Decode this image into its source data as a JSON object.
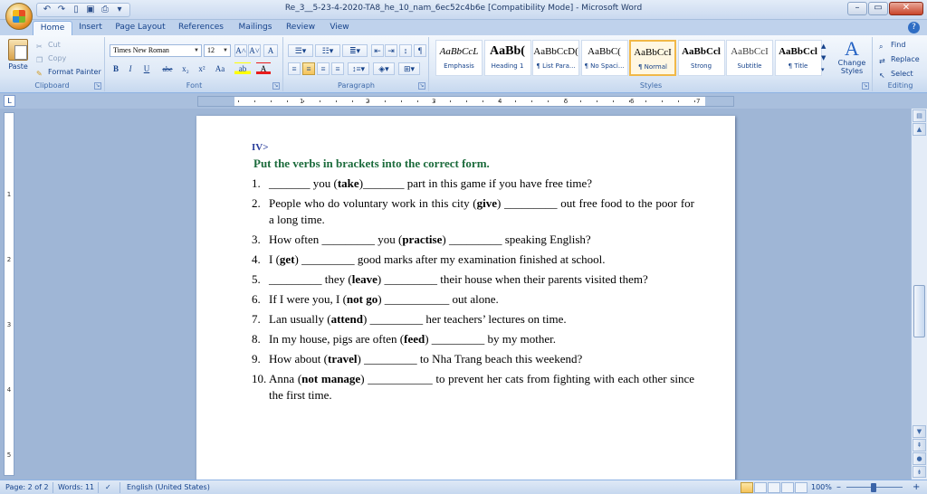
{
  "window": {
    "title": "Re_3__5-23-4-2020-TA8_he_10_nam_6ec52c4b6e [Compatibility Mode] - Microsoft Word",
    "minimize": "–",
    "maximize": "▭",
    "close": "✕"
  },
  "tabs": [
    "Home",
    "Insert",
    "Page Layout",
    "References",
    "Mailings",
    "Review",
    "View"
  ],
  "help_label": "?",
  "clipboard": {
    "paste": "Paste",
    "cut": "Cut",
    "copy": "Copy",
    "format_painter": "Format Painter",
    "label": "Clipboard"
  },
  "font": {
    "family": "Times New Roman",
    "size": "12",
    "grow": "A˄",
    "shrink": "A˅",
    "clear": "A",
    "bold": "B",
    "italic": "I",
    "underline": "U",
    "strike": "abe",
    "subscript": "x₂",
    "superscript": "x²",
    "change_case": "Aa",
    "highlight": "ab",
    "font_color": "A",
    "label": "Font"
  },
  "paragraph": {
    "label": "Paragraph",
    "pilcrow": "¶"
  },
  "styles": {
    "items": [
      {
        "sample": "AaBbCcL",
        "name": "Emphasis"
      },
      {
        "sample": "AaBb(",
        "name": "Heading 1"
      },
      {
        "sample": "AaBbCcD(",
        "name": "¶ List Para..."
      },
      {
        "sample": "AaBbC(",
        "name": "¶ No Spaci..."
      },
      {
        "sample": "AaBbCcI",
        "name": "¶ Normal"
      },
      {
        "sample": "AaBbCcl",
        "name": "Strong"
      },
      {
        "sample": "AaBbCcI",
        "name": "Subtitle"
      },
      {
        "sample": "AaBbCcl",
        "name": "¶ Title"
      }
    ],
    "selected_index": 4,
    "change_styles": "Change Styles",
    "label": "Styles"
  },
  "editing": {
    "find": "Find",
    "replace": "Replace",
    "select": "Select",
    "label": "Editing"
  },
  "ruler": {
    "tab_selector": "L",
    "numbers": [
      "1",
      "2",
      "3",
      "4",
      "5",
      "6",
      "7"
    ]
  },
  "vruler_numbers": [
    "1",
    "2",
    "3",
    "4",
    "5"
  ],
  "document": {
    "section_number": "IV>",
    "section_title": "Put the verbs in brackets into the correct form.",
    "questions": [
      {
        "n": "1.",
        "parts": [
          [
            "",
            "_______ you ("
          ],
          [
            "b",
            "take"
          ],
          [
            "",
            ")_______ part in this game if you have free time?"
          ]
        ]
      },
      {
        "n": "2.",
        "parts": [
          [
            "",
            "People who do voluntary work in this city ("
          ],
          [
            "b",
            "give"
          ],
          [
            "",
            ") _________ out free food to the poor for a long time."
          ]
        ]
      },
      {
        "n": "3.",
        "parts": [
          [
            "",
            "How often _________ you ("
          ],
          [
            "b",
            "practise"
          ],
          [
            "",
            ") _________ speaking English?"
          ]
        ]
      },
      {
        "n": "4.",
        "parts": [
          [
            "",
            "I ("
          ],
          [
            "b",
            "get"
          ],
          [
            "",
            ") _________ good marks after my examination finished at school."
          ]
        ]
      },
      {
        "n": "5.",
        "parts": [
          [
            "",
            "_________ they ("
          ],
          [
            "b",
            "leave"
          ],
          [
            "",
            ") _________ their house when their parents visited them?"
          ]
        ]
      },
      {
        "n": "6.",
        "parts": [
          [
            "",
            "If I were you, I ("
          ],
          [
            "b",
            "not go"
          ],
          [
            "",
            ") ___________ out alone."
          ]
        ]
      },
      {
        "n": "7.",
        "parts": [
          [
            "",
            "Lan usually ("
          ],
          [
            "b",
            "attend"
          ],
          [
            "",
            ") _________ her teachers’ lectures on time."
          ]
        ]
      },
      {
        "n": "8.",
        "parts": [
          [
            "",
            "In my house, pigs are often ("
          ],
          [
            "b",
            "feed"
          ],
          [
            "",
            ") _________ by my mother."
          ]
        ]
      },
      {
        "n": "9.",
        "parts": [
          [
            "",
            "How about ("
          ],
          [
            "b",
            "travel"
          ],
          [
            "",
            ") _________ to Nha Trang beach this weekend?"
          ]
        ]
      },
      {
        "n": "10.",
        "parts": [
          [
            "",
            "Anna ("
          ],
          [
            "b",
            "not manage"
          ],
          [
            "",
            ") ___________ to prevent her cats from fighting with each other since the first time."
          ]
        ]
      }
    ]
  },
  "status": {
    "page": "Page: 2 of 2",
    "words": "Words: 11",
    "language": "English (United States)",
    "zoom": "100%",
    "zoom_minus": "–",
    "zoom_plus": "+"
  },
  "colors": {
    "section_number": "#2b3f9c",
    "section_title": "#1c6b3c",
    "ribbon_text": "#15428b"
  }
}
